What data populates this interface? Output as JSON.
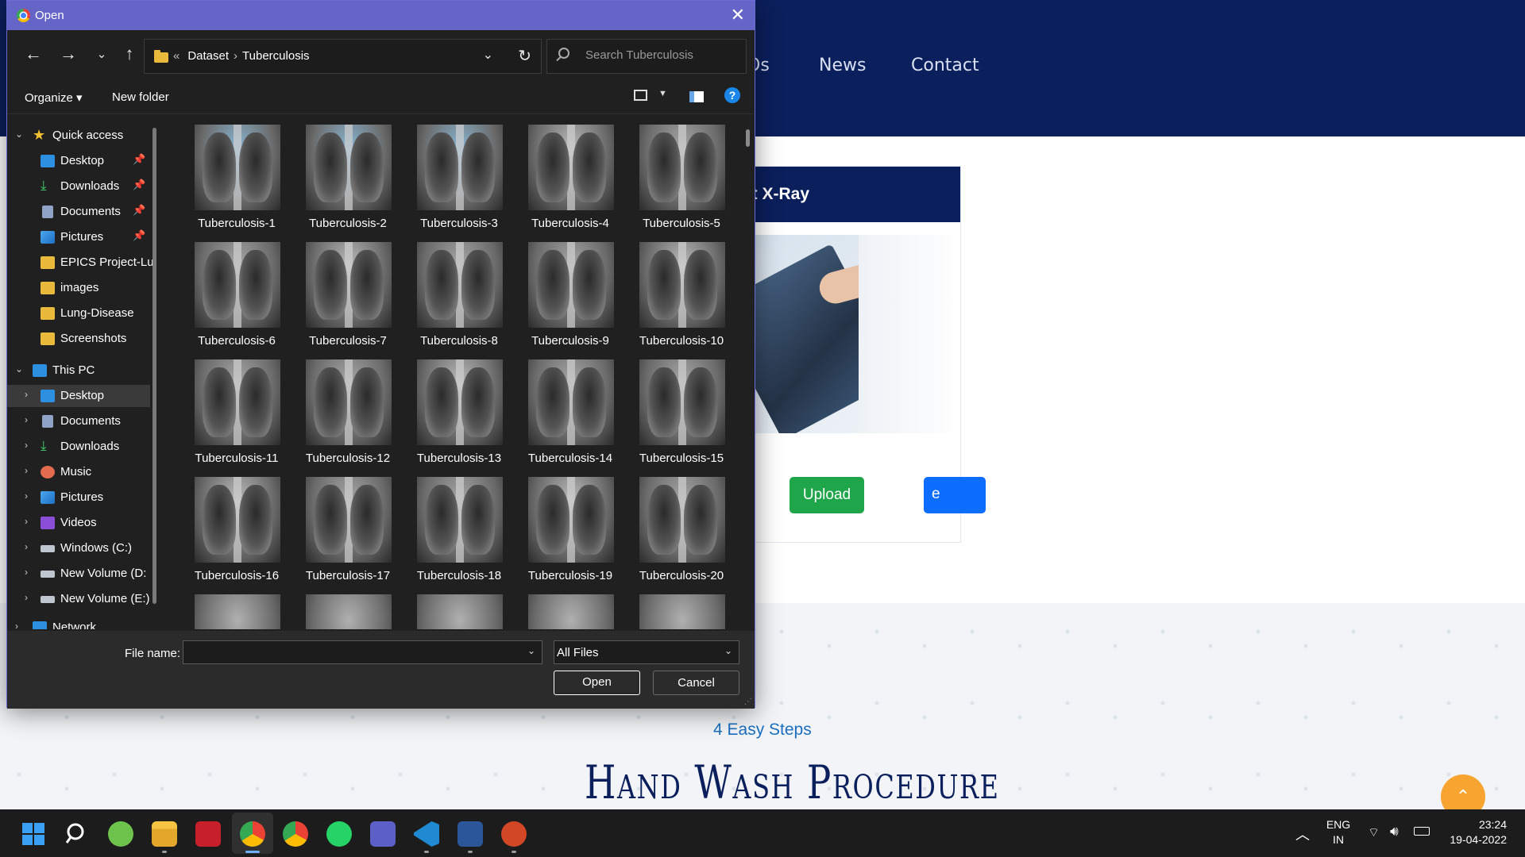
{
  "website": {
    "nav_items": [
      "Os",
      "News",
      "Contact"
    ],
    "card_title": "t X-Ray",
    "browse_fragment": "e",
    "upload_label": "Upload",
    "section_kicker": "4 Easy Steps",
    "section_title": "Hand Wash Procedure",
    "scroll_top_glyph": "⌃"
  },
  "dialog": {
    "title": "Open",
    "breadcrumb": {
      "prefix": "«",
      "parent": "Dataset",
      "sep": "›",
      "current": "Tuberculosis"
    },
    "search_placeholder": "Search Tuberculosis",
    "toolbar": {
      "organize": "Organize ▾",
      "new_folder": "New folder",
      "help": "?"
    },
    "sidebar": {
      "quick_access": "Quick access",
      "quick_items": [
        "Desktop",
        "Downloads",
        "Documents",
        "Pictures",
        "EPICS Project-Lu",
        "images",
        "Lung-Disease",
        "Screenshots"
      ],
      "this_pc": "This PC",
      "pc_items": [
        "Desktop",
        "Documents",
        "Downloads",
        "Music",
        "Pictures",
        "Videos",
        "Windows (C:)",
        "New Volume (D:",
        "New Volume (E:)"
      ],
      "network": "Network"
    },
    "files": [
      "Tuberculosis-1",
      "Tuberculosis-2",
      "Tuberculosis-3",
      "Tuberculosis-4",
      "Tuberculosis-5",
      "Tuberculosis-6",
      "Tuberculosis-7",
      "Tuberculosis-8",
      "Tuberculosis-9",
      "Tuberculosis-10",
      "Tuberculosis-11",
      "Tuberculosis-12",
      "Tuberculosis-13",
      "Tuberculosis-14",
      "Tuberculosis-15",
      "Tuberculosis-16",
      "Tuberculosis-17",
      "Tuberculosis-18",
      "Tuberculosis-19",
      "Tuberculosis-20"
    ],
    "file_name_label": "File name:",
    "file_name_value": "",
    "file_type": "All Files",
    "open_label": "Open",
    "cancel_label": "Cancel"
  },
  "taskbar": {
    "apps": [
      "start",
      "search",
      "utorrent",
      "file-explorer",
      "app-red",
      "chrome-active",
      "chrome",
      "whatsapp",
      "teams",
      "vscode",
      "word",
      "powerpoint"
    ],
    "lang_1": "ENG",
    "lang_2": "IN",
    "time": "23:24",
    "date": "19-04-2022"
  },
  "colors": {
    "header_navy": "#0b1f5c",
    "dialog_title": "#6564c7",
    "upload_green": "#1fa54a",
    "accent_blue": "#0d6efd"
  }
}
